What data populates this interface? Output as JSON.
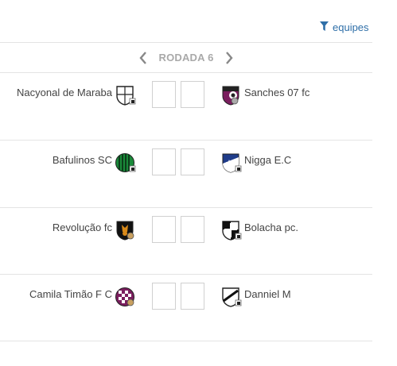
{
  "header": {
    "filter_label": "equipes"
  },
  "round_nav": {
    "title": "RODADA 6"
  },
  "matches": [
    {
      "home": {
        "name": "Nacyonal de Maraba"
      },
      "away": {
        "name": "Sanches 07 fc"
      }
    },
    {
      "home": {
        "name": "Bafulinos SC"
      },
      "away": {
        "name": "Nigga E.C"
      }
    },
    {
      "home": {
        "name": "Revolução fc"
      },
      "away": {
        "name": "Bolacha pc."
      }
    },
    {
      "home": {
        "name": "Camila Timão F C"
      },
      "away": {
        "name": "Danniel M"
      }
    }
  ],
  "colors": {
    "accent": "#2f6fa8",
    "round_title": "#a9a9a9",
    "divider": "#e4e4e4"
  }
}
